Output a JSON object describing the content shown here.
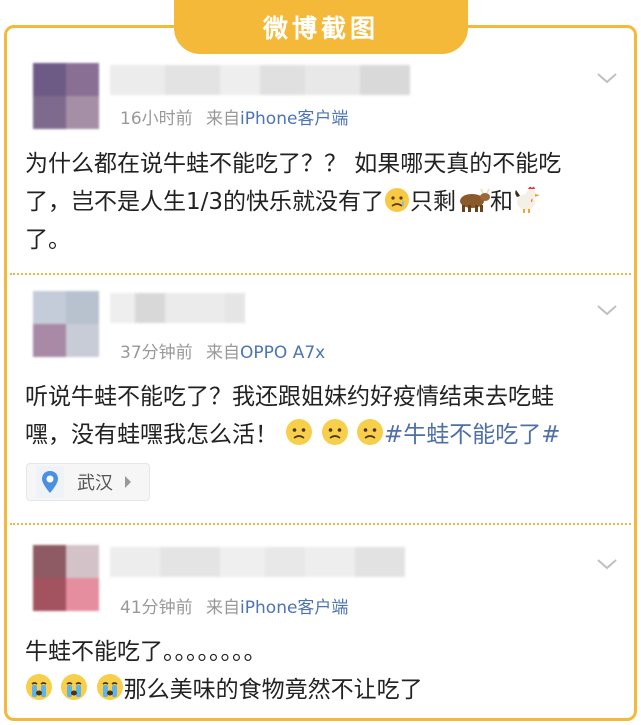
{
  "header": {
    "title": "微博截图"
  },
  "posts": [
    {
      "meta_time": "16小时前",
      "meta_from": "来自",
      "meta_source": "iPhone客户端",
      "lines": [
        "为什么都在说牛蛙不能吃了？？ 如果哪天真的不能吃",
        "了，岂不是人生1/3的快乐就没有了",
        "只剩",
        "和",
        "了。"
      ]
    },
    {
      "meta_time": "37分钟前",
      "meta_from": "来自",
      "meta_source": "OPPO A7x",
      "lines": [
        "听说牛蛙不能吃了？我还跟姐妹约好疫情结束去吃蛙",
        "嘿，没有蛙嘿我怎么活！"
      ],
      "hashtag": "#牛蛙不能吃了#",
      "location": "武汉"
    },
    {
      "meta_time": "41分钟前",
      "meta_from": "来自",
      "meta_source": "iPhone客户端",
      "lines": [
        "牛蛙不能吃了。。。。。。。。",
        "那么美味的食物竟然不让吃了"
      ]
    }
  ],
  "icons": [
    "chevron-down-icon",
    "sad-emoji-icon",
    "cow-emoji-icon",
    "rooster-emoji-icon",
    "frown-emoji-icon",
    "crying-emoji-icon",
    "location-pin-icon",
    "arrow-right-icon"
  ],
  "colors": {
    "accent": "#f5b93a",
    "link": "#4c74b5",
    "hashtag": "#4f6fa8",
    "meta": "#999999"
  }
}
